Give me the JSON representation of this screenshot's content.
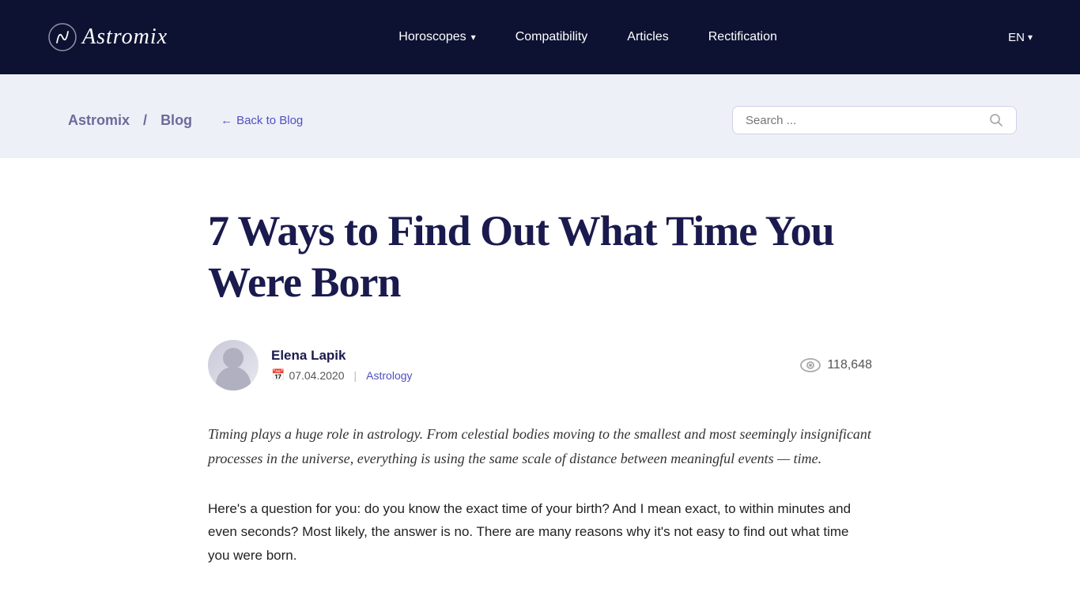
{
  "nav": {
    "logo": "Astromix",
    "links": [
      {
        "label": "Horoscopes",
        "hasDropdown": true
      },
      {
        "label": "Compatibility",
        "hasDropdown": false
      },
      {
        "label": "Articles",
        "hasDropdown": false
      },
      {
        "label": "Rectification",
        "hasDropdown": false
      }
    ],
    "language": "EN"
  },
  "breadcrumb": {
    "site": "Astromix",
    "section": "Blog",
    "separator": "/",
    "back_label": "Back to Blog"
  },
  "search": {
    "placeholder": "Search ..."
  },
  "article": {
    "title": "7 Ways to Find Out What Time You Were Born",
    "author": {
      "name": "Elena Lapik",
      "date": "07.04.2020",
      "category": "Astrology"
    },
    "views": "118,648",
    "intro": "Timing plays a huge role in astrology. From celestial bodies moving to the smallest and most seemingly insignificant processes in the universe, everything is using the same scale of distance between meaningful events — time.",
    "body": "Here's a question for you: do you know the exact time of your birth? And I mean exact, to within minutes and even seconds? Most likely, the answer is no. There are many reasons why it's not easy to find out what time you were born."
  }
}
